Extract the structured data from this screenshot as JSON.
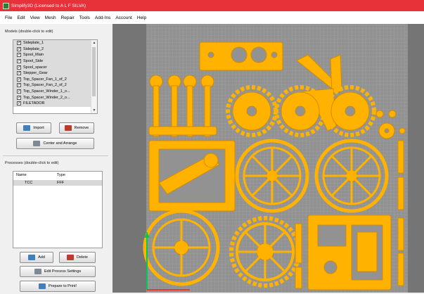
{
  "window": {
    "title": "Simplify3D (Licensed to A L F SILVA)"
  },
  "menu": [
    "File",
    "Edit",
    "View",
    "Mesh",
    "Repair",
    "Tools",
    "Add-Ins",
    "Account",
    "Help"
  ],
  "models": {
    "header": "Models (double-click to edit)",
    "items": [
      {
        "label": "Sideplate_1",
        "checked": true
      },
      {
        "label": "Sideplate_2",
        "checked": true
      },
      {
        "label": "Spool_Main",
        "checked": true
      },
      {
        "label": "Spool_Side",
        "checked": true
      },
      {
        "label": "Spool_spacer",
        "checked": true
      },
      {
        "label": "Stepper_Gear",
        "checked": true
      },
      {
        "label": "Top_Spacer_Fan_1_of_2",
        "checked": true
      },
      {
        "label": "Top_Spacer_Fan_2_of_2",
        "checked": true
      },
      {
        "label": "Top_Spacer_Winder_1_o...",
        "checked": true
      },
      {
        "label": "Top_Spacer_Winder_2_o...",
        "checked": true
      },
      {
        "label": "FILETADOR",
        "checked": true
      }
    ],
    "import_label": "Import",
    "remove_label": "Remove",
    "center_label": "Center and Arrange"
  },
  "processes": {
    "header": "Processes (double-click to edit)",
    "col_name": "Name",
    "col_type": "Type",
    "rows": [
      {
        "name": "TCC",
        "type": "FFF"
      }
    ],
    "add_label": "Add",
    "delete_label": "Delete",
    "edit_label": "Edit Process Settings",
    "prepare_label": "Prepare to Print!"
  },
  "colors": {
    "titlebar": "#e8323a",
    "part": "#ffb300",
    "bed": "#929292",
    "viewport": "#757575"
  },
  "icons": {
    "app": "simplify3d-app-icon",
    "import": "import-icon",
    "remove": "remove-icon",
    "center": "center-arrange-icon",
    "add": "add-process-icon",
    "delete": "delete-process-icon",
    "edit": "edit-settings-icon",
    "prepare": "prepare-print-icon"
  }
}
